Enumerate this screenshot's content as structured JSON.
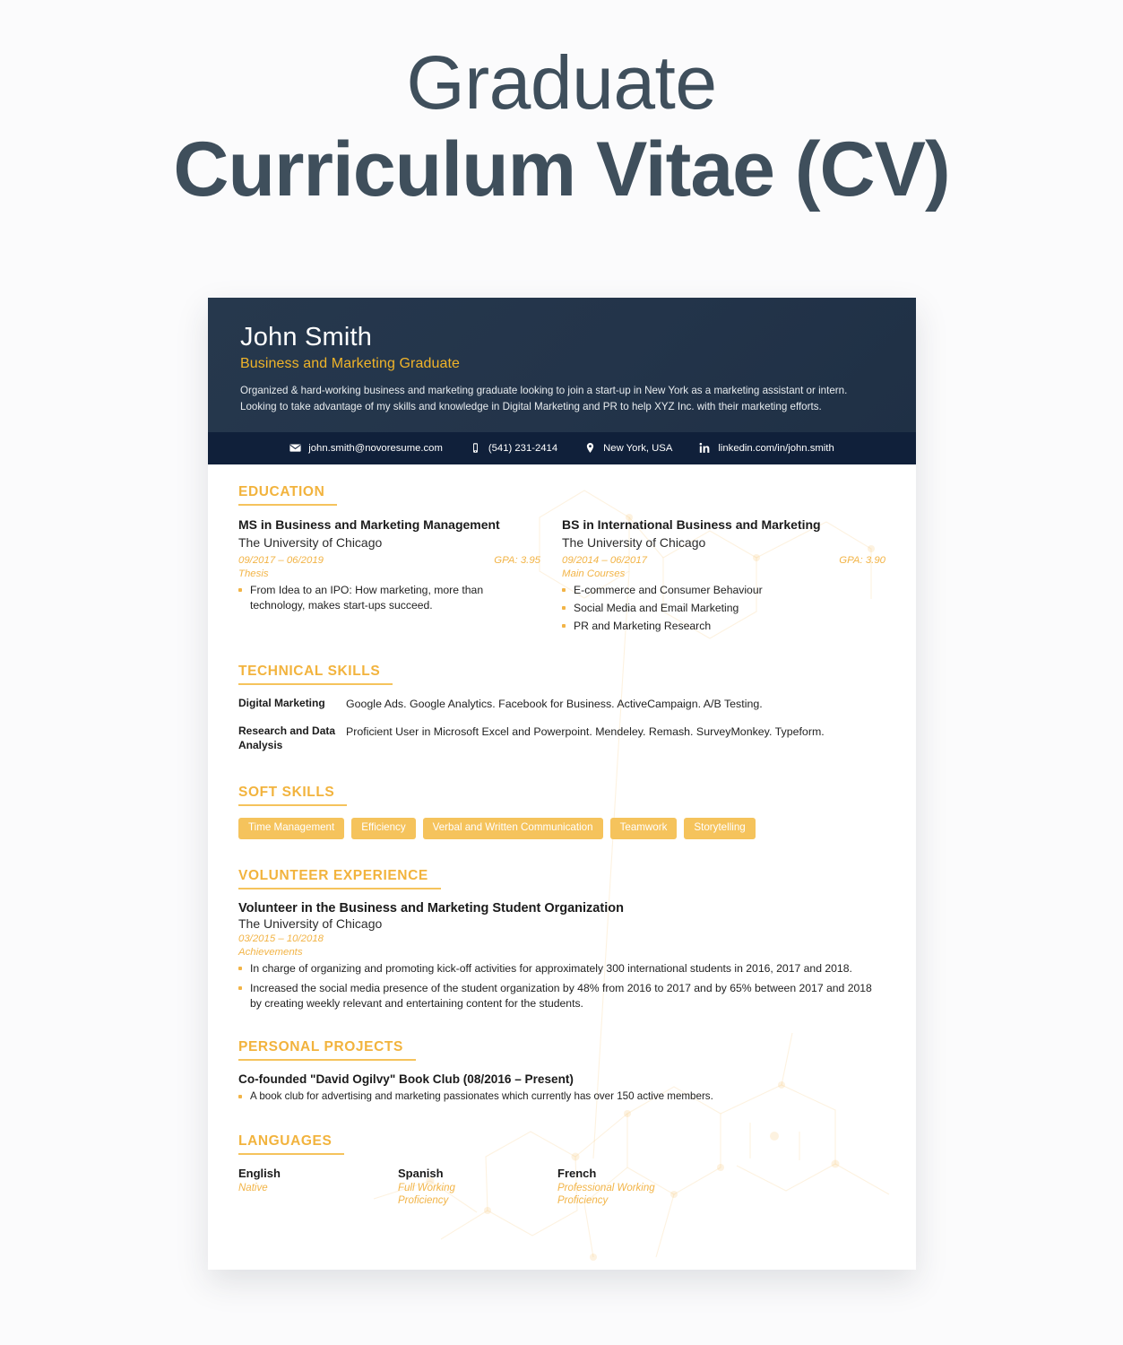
{
  "page": {
    "title_line1": "Graduate",
    "title_line2": "Curriculum Vitae (CV)",
    "accent_gold": "#f2b33d",
    "chip_gold": "#f5c35c",
    "header_navy": "#26384d",
    "contactbar_navy": "#10203a",
    "page_bg": "#fbfbfc"
  },
  "cv": {
    "name": "John Smith",
    "role": "Business and Marketing Graduate",
    "summary": "Organized & hard-working business and marketing graduate looking to join a start-up in New York as a marketing assistant or intern. Looking to take advantage of my skills and knowledge in Digital Marketing and PR to help XYZ Inc. with their marketing efforts.",
    "contact": [
      {
        "icon": "email-icon",
        "text": "john.smith@novoresume.com"
      },
      {
        "icon": "phone-icon",
        "text": "(541) 231-2414"
      },
      {
        "icon": "location-pin-icon",
        "text": "New York, USA"
      },
      {
        "icon": "linkedin-icon",
        "text": "linkedin.com/in/john.smith"
      }
    ],
    "sections": {
      "education": {
        "title": "EDUCATION",
        "entries": [
          {
            "degree": "MS in Business and Marketing Management",
            "school": "The University of Chicago",
            "dates": "09/2017 – 06/2019",
            "gpa": "GPA: 3.95",
            "sublabel": "Thesis",
            "bullets": [
              "From Idea to an IPO: How marketing, more than technology, makes start-ups succeed."
            ]
          },
          {
            "degree": "BS in International Business and Marketing",
            "school": "The University of Chicago",
            "dates": "09/2014 – 06/2017",
            "gpa": "GPA: 3.90",
            "sublabel": "Main Courses",
            "bullets": [
              "E-commerce and Consumer Behaviour",
              "Social Media and Email Marketing",
              "PR and Marketing Research"
            ]
          }
        ]
      },
      "technical_skills": {
        "title": "TECHNICAL SKILLS",
        "rows": [
          {
            "label": "Digital Marketing",
            "value": "Google Ads. Google Analytics. Facebook for Business. ActiveCampaign. A/B Testing."
          },
          {
            "label": "Research and Data Analysis",
            "value": "Proficient User in Microsoft Excel and Powerpoint. Mendeley. Remash. SurveyMonkey. Typeform."
          }
        ]
      },
      "soft_skills": {
        "title": "SOFT SKILLS",
        "chips": [
          "Time Management",
          "Efficiency",
          "Verbal and Written Communication",
          "Teamwork",
          "Storytelling"
        ]
      },
      "volunteer": {
        "title": "VOLUNTEER EXPERIENCE",
        "role": "Volunteer in the Business and Marketing Student Organization",
        "organization": "The University of Chicago",
        "dates": "03/2015 – 10/2018",
        "sublabel": "Achievements",
        "bullets": [
          "In charge of organizing and promoting kick-off activities for approximately 300 international students in 2016, 2017 and 2018.",
          "Increased the social media presence of the student organization by 48% from 2016 to 2017 and by 65% between 2017 and 2018 by creating weekly relevant and entertaining content for the students."
        ]
      },
      "personal_projects": {
        "title": "PERSONAL PROJECTS",
        "project_title": "Co-founded \"David Ogilvy\" Book Club (08/2016 – Present)",
        "bullets": [
          "A book club for advertising and marketing passionates which currently has over 150 active members."
        ]
      },
      "languages": {
        "title": "LANGUAGES",
        "items": [
          {
            "name": "English",
            "level": "Native"
          },
          {
            "name": "Spanish",
            "level": "Full Working Proficiency"
          },
          {
            "name": "French",
            "level": "Professional Working Proficiency"
          }
        ]
      }
    }
  }
}
